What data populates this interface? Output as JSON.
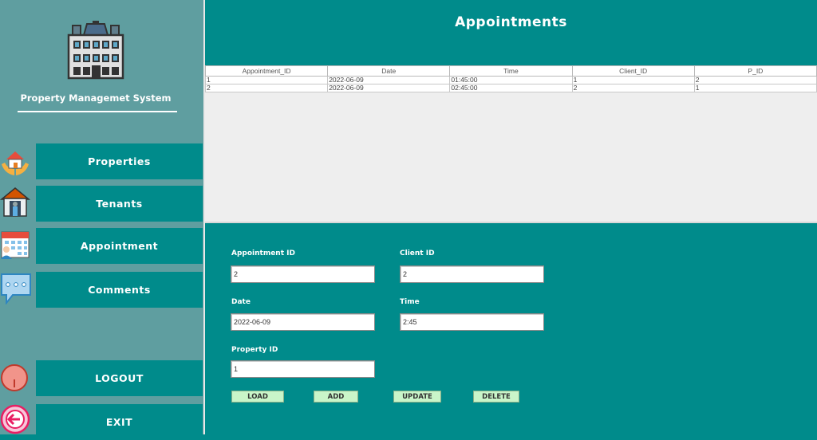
{
  "sidebar": {
    "app_title": "Property Managemet System",
    "nav": [
      {
        "label": "Properties",
        "icon": "hands-house-icon"
      },
      {
        "label": "Tenants",
        "icon": "house-person-icon"
      },
      {
        "label": "Appointment",
        "icon": "calendar-person-icon"
      },
      {
        "label": "Comments",
        "icon": "chat-bubble-icon"
      }
    ],
    "logout_label": "LOGOUT",
    "exit_label": "EXIT"
  },
  "main": {
    "title": "Appointments",
    "table": {
      "columns": [
        "Appointment_ID",
        "Date",
        "Time",
        "Client_ID",
        "P_ID"
      ],
      "rows": [
        [
          "1",
          "2022-06-09",
          "01:45:00",
          "1",
          "2"
        ],
        [
          "2",
          "2022-06-09",
          "02:45:00",
          "2",
          "1"
        ]
      ]
    },
    "form": {
      "appointment_id_label": "Appointment ID",
      "appointment_id_value": "2",
      "client_id_label": "Client ID",
      "client_id_value": "2",
      "date_label": "Date",
      "date_value": "2022-06-09",
      "time_label": "Time",
      "time_value": "2:45",
      "property_id_label": "Property ID",
      "property_id_value": "1"
    },
    "buttons": {
      "load": "LOAD",
      "add": "ADD",
      "update": "UPDATE",
      "delete": "DELETE"
    }
  },
  "colors": {
    "sidebar": "#5F9EA0",
    "teal": "#008B8B",
    "button_green": "#C9F5C9"
  }
}
